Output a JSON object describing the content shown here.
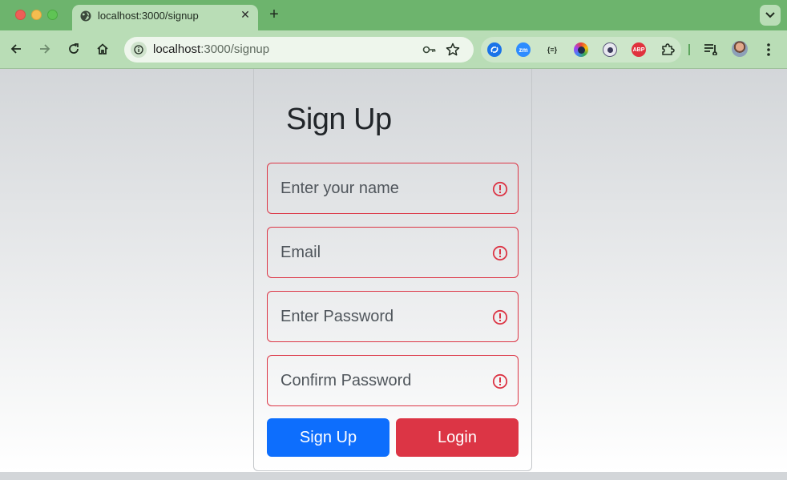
{
  "browser": {
    "tab_title": "localhost:3000/signup",
    "new_tab_symbol": "+",
    "close_tab_symbol": "✕",
    "url_host": "localhost",
    "url_path": ":3000/signup",
    "extensions": [
      {
        "name": "sync-extension-icon",
        "label": "",
        "color": "#1a73e8"
      },
      {
        "name": "zoom-extension-icon",
        "label": "zm",
        "color": "#2d8cff"
      },
      {
        "name": "json-extension-icon",
        "label": "{≡}",
        "color": "#cde6ca"
      },
      {
        "name": "color-picker-extension-icon",
        "label": "",
        "color": "#444444"
      },
      {
        "name": "profile-extension-icon",
        "label": "",
        "color": "#5a5a7a"
      },
      {
        "name": "adblock-extension-icon",
        "label": "ABP",
        "color": "#e0323d"
      }
    ]
  },
  "page": {
    "title": "Sign Up",
    "fields": [
      {
        "placeholder": "Enter your name"
      },
      {
        "placeholder": "Email"
      },
      {
        "placeholder": "Enter Password"
      },
      {
        "placeholder": "Confirm Password"
      }
    ],
    "signup_button": "Sign Up",
    "login_button": "Login"
  },
  "colors": {
    "error": "#dc3545",
    "primary": "#0d6efd",
    "danger": "#dc3545",
    "chrome_green": "#6db46d"
  }
}
